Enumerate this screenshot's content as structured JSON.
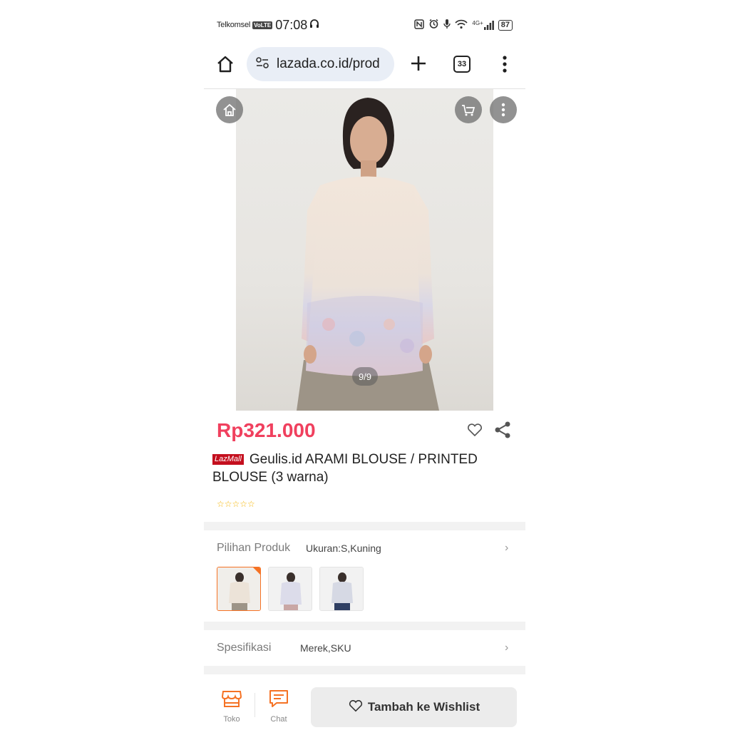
{
  "status_bar": {
    "carrier": "Telkomsel",
    "volte": "VoLTE",
    "time": "07:08",
    "network": "4G+",
    "battery": "87"
  },
  "browser": {
    "url": "lazada.co.id/prod",
    "tab_count": "33"
  },
  "gallery": {
    "counter": "9/9"
  },
  "product": {
    "price": "Rp321.000",
    "badge": "LazMall",
    "title": "Geulis.id ARAMI BLOUSE / PRINTED BLOUSE (3 warna)",
    "rating_stars": "☆☆☆☆☆",
    "rating_value": 0
  },
  "options": {
    "label": "Pilihan Produk",
    "value": "Ukuran:S,Kuning",
    "chevron": "›",
    "variants": [
      {
        "name": "Kuning",
        "color": "#ece3d8",
        "selected": true
      },
      {
        "name": "variant-2",
        "color": "#dcdcea",
        "selected": false
      },
      {
        "name": "variant-3",
        "color": "#d6d9e4",
        "selected": false
      }
    ]
  },
  "specs": {
    "label": "Spesifikasi",
    "value": "Merek,SKU",
    "chevron": "›"
  },
  "bottom_bar": {
    "store_label": "Toko",
    "chat_label": "Chat",
    "wishlist_label": "Tambah ke Wishlist"
  },
  "colors": {
    "price": "#f0405e",
    "accent_orange": "#f57224",
    "lazmall_red": "#c40f1e",
    "url_pill": "#e9eef6"
  }
}
